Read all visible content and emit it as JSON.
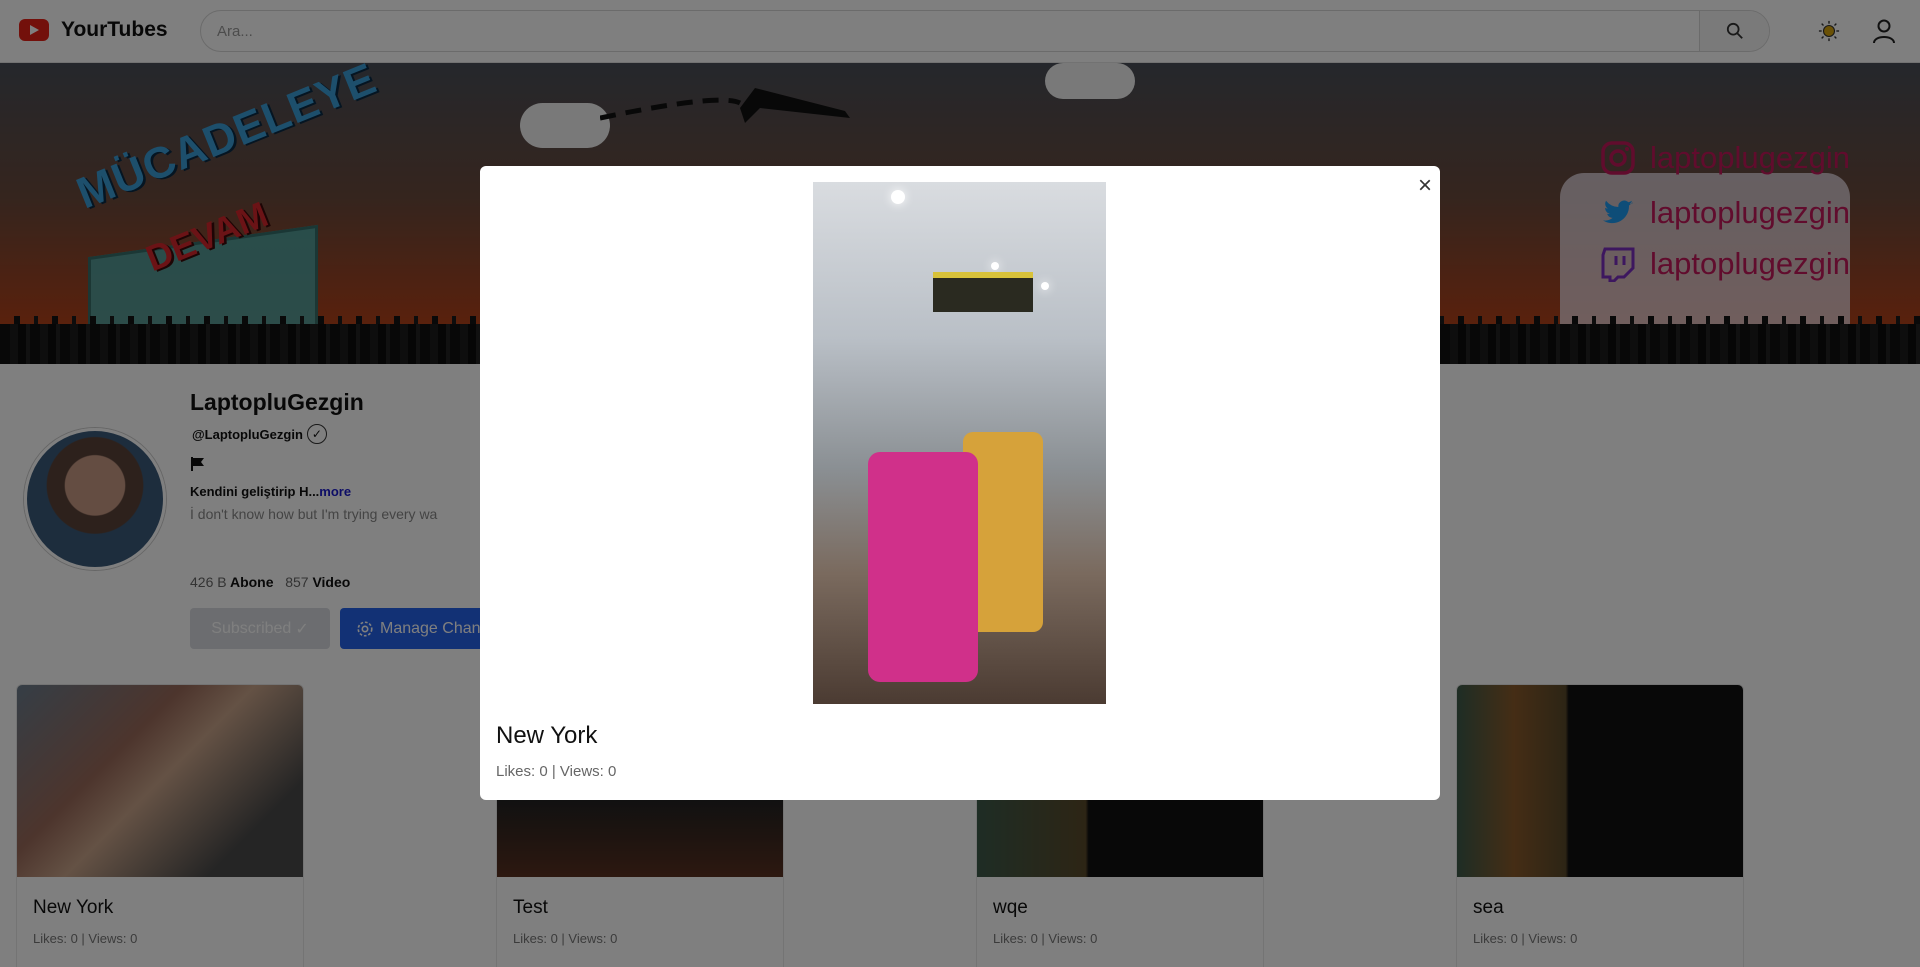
{
  "header": {
    "logo_text": "YourTubes",
    "search_placeholder": "Ara..."
  },
  "banner": {
    "title_line1": "MÜCADELEYE",
    "title_line2": "DEVAM",
    "socials": [
      {
        "platform": "instagram",
        "handle": "laptoplugezgin"
      },
      {
        "platform": "twitter",
        "handle": "laptoplugezgin"
      },
      {
        "platform": "twitch",
        "handle": "laptoplugezgin"
      }
    ]
  },
  "channel": {
    "name": "LaptopluGezgin",
    "handle": "@LaptopluGezgin",
    "description_short": "Kendini geliştirip H...",
    "more_label": "more",
    "description_line2": "İ don't know how but I'm trying every wa",
    "subscriber_count": "426 B",
    "subscriber_label": "Abone",
    "video_count": "857",
    "video_label": "Video",
    "subscribed_label": "Subscribed",
    "manage_label": "Manage Chan"
  },
  "videos": [
    {
      "title": "New York",
      "meta": "Likes: 0 | Views: 0"
    },
    {
      "title": "Test",
      "meta": "Likes: 0 | Views: 0"
    },
    {
      "title": "wqe",
      "meta": "Likes: 0 | Views: 0"
    },
    {
      "title": "sea",
      "meta": "Likes: 0 | Views: 0"
    }
  ],
  "modal": {
    "title": "New York",
    "meta": "Likes: 0 | Views: 0",
    "close_icon": "×"
  },
  "colors": {
    "brand_red": "#e62117",
    "manage_blue": "#2563eb",
    "more_link": "#1a1acc"
  }
}
